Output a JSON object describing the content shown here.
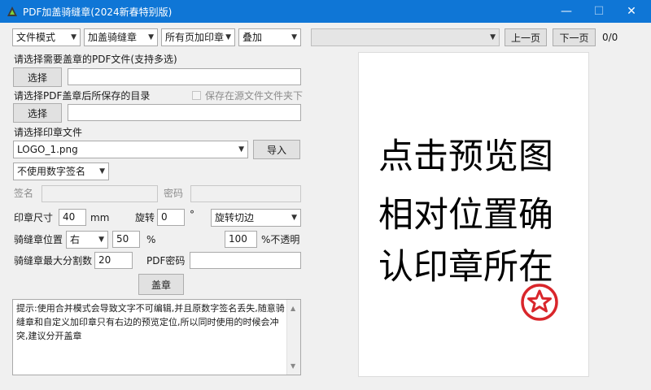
{
  "window": {
    "title": "PDF加盖骑缝章(2024新春特别版)",
    "minimize": "—",
    "maximize": "☐",
    "close": "✕"
  },
  "toolbar": {
    "mode_value": "文件模式",
    "stamp_type_value": "加盖骑缝章",
    "page_scope_value": "所有页加印章",
    "overlay_value": "叠加",
    "page_select_value": "",
    "prev_label": "上一页",
    "next_label": "下一页",
    "page_counter": "0/0"
  },
  "pdf_select": {
    "label": "请选择需要盖章的PDF文件(支持多选)",
    "button": "选择",
    "path": ""
  },
  "output_dir": {
    "label": "请选择PDF盖章后所保存的目录",
    "checkbox_label": "保存在源文件文件夹下",
    "button": "选择",
    "path": ""
  },
  "stamp_file": {
    "label": "请选择印章文件",
    "value": "LOGO_1.png",
    "import_button": "导入"
  },
  "signature": {
    "select_value": "不使用数字签名",
    "sign_name_label": "签名",
    "password_label": "密码"
  },
  "stamp_size": {
    "label": "印章尺寸",
    "value": "40",
    "unit": "mm",
    "rotate_label": "旋转",
    "rotate_value": "0",
    "degree": "°",
    "rotate_mode": "旋转切边"
  },
  "seam_position": {
    "label": "骑缝章位置",
    "side_value": "右",
    "percent_value": "50",
    "percent_unit": "%",
    "opacity_value": "100",
    "opacity_unit": "%不透明"
  },
  "split": {
    "label": "骑缝章最大分割数",
    "value": "20",
    "pdf_password_label": "PDF密码",
    "pdf_password_value": ""
  },
  "stamp_button": "盖章",
  "tip_text": "提示:使用合并模式会导致文字不可编辑,并且原数字签名丢失,随意骑缝章和自定义加印章只有右边的预览定位,所以同时使用的时候会冲突,建议分开盖章",
  "preview": {
    "lines": [
      "点击预览图",
      "相对位置确",
      "认印章所在"
    ]
  },
  "colors": {
    "titlebar": "#0f76d6",
    "seal_red": "#d9262b"
  }
}
